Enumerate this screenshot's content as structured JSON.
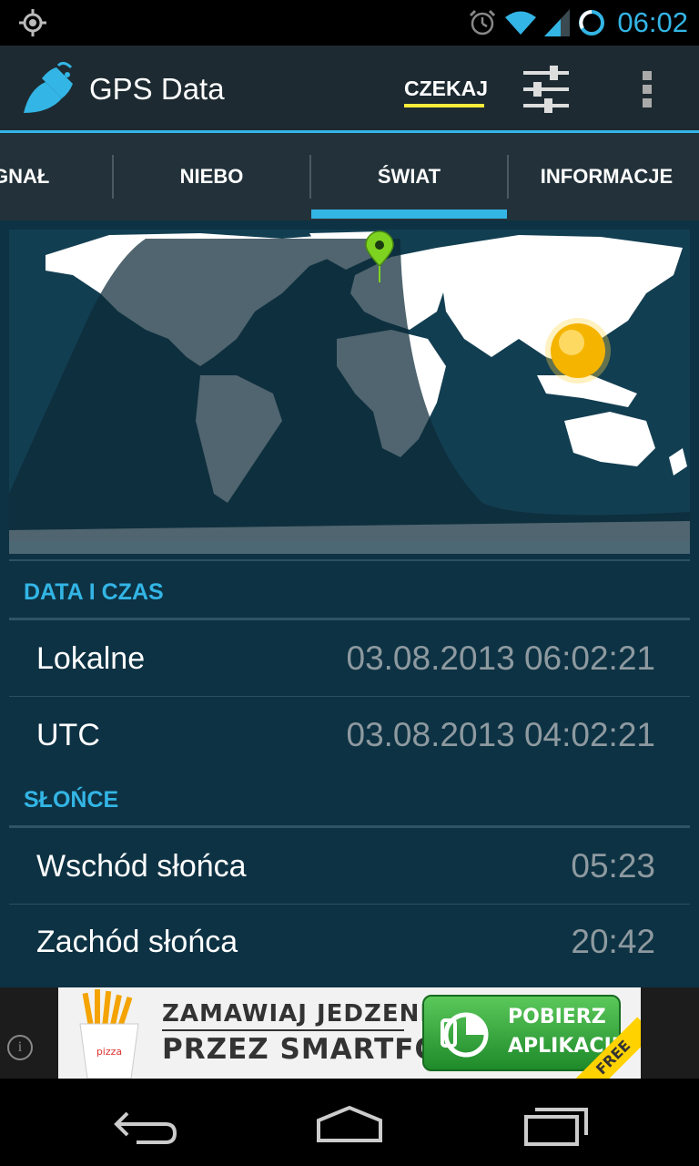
{
  "status_bar": {
    "time": "06:02",
    "icons": [
      "gps-icon",
      "alarm-icon",
      "wifi-icon",
      "signal-icon",
      "battery-icon"
    ]
  },
  "action_bar": {
    "title": "GPS Data",
    "wait_label": "CZEKAJ",
    "icons": [
      "app-logo-icon",
      "settings-sliders-icon",
      "overflow-menu-icon"
    ]
  },
  "tabs": [
    {
      "label": "GNAŁ"
    },
    {
      "label": "NIEBO"
    },
    {
      "label": "ŚWIAT"
    },
    {
      "label": "INFORMACJE"
    }
  ],
  "sections": {
    "datetime": {
      "header": "DATA I CZAS",
      "rows": [
        {
          "label": "Lokalne",
          "value": "03.08.2013 06:02:21"
        },
        {
          "label": "UTC",
          "value": "03.08.2013 04:02:21"
        }
      ]
    },
    "sun": {
      "header": "SŁOŃCE",
      "rows": [
        {
          "label": "Wschód słońca",
          "value": "05:23"
        },
        {
          "label": "Zachód słońca",
          "value": "20:42"
        }
      ]
    }
  },
  "ad": {
    "line1": "ZAMAWIAJ JEDZENIE",
    "line2": "PRZEZ SMARTFON!",
    "cta_line1": "POBIERZ",
    "cta_line2": "APLIKACJĘ",
    "badge": "FREE",
    "info_symbol": "i"
  },
  "colors": {
    "accent": "#33b5e5",
    "action_bar": "#1d2a31",
    "content_bg": "#0d3243",
    "wait_underline": "#ffeb3b",
    "marker": "#7ed321",
    "sun": "#f5b400"
  },
  "nav_bar": {
    "icons": [
      "back-icon",
      "home-icon",
      "recent-apps-icon"
    ]
  }
}
